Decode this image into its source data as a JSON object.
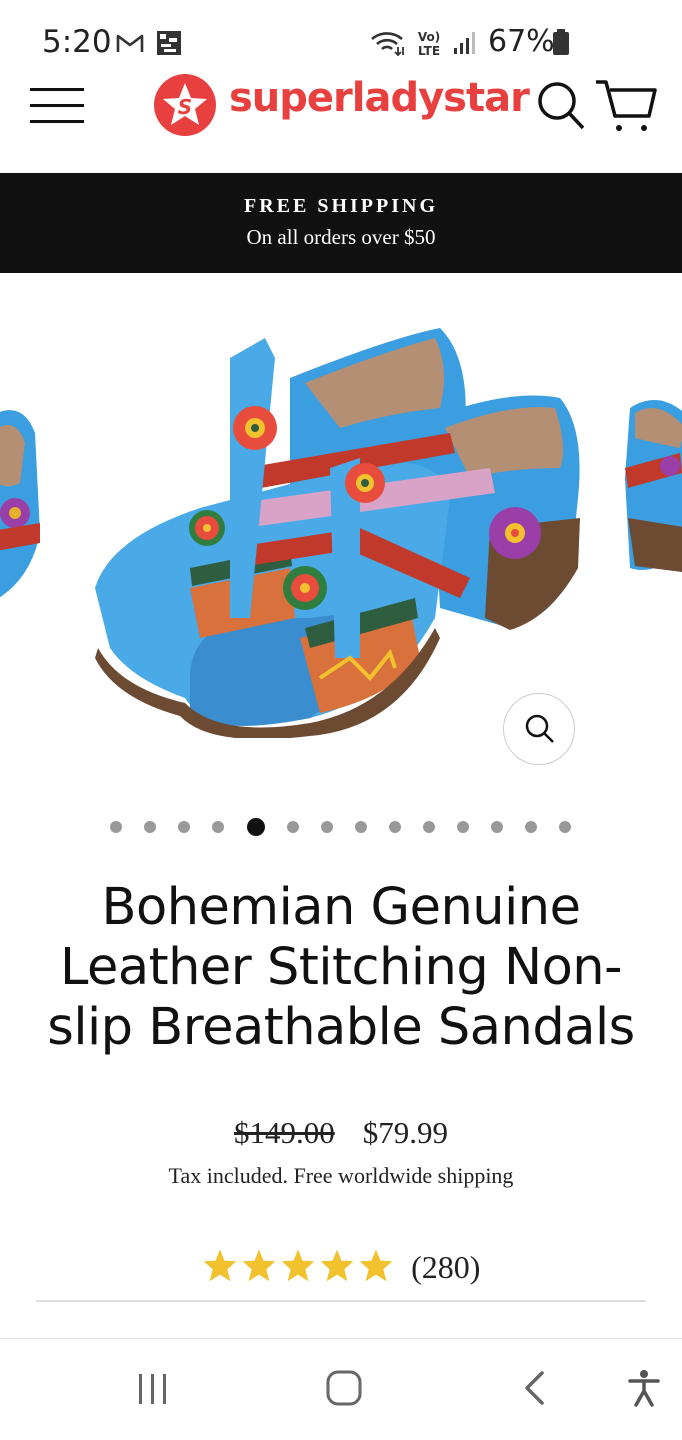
{
  "status_bar": {
    "time": "5:20",
    "network": "LTE",
    "battery": "67%",
    "icons": [
      "gmail-icon",
      "gallery-icon",
      "wifi-icon",
      "volte-icon",
      "signal-icon",
      "battery-icon"
    ]
  },
  "header": {
    "brand": "superladystar",
    "brand_color": "#e8403f",
    "icons": [
      "hamburger-icon",
      "search-icon",
      "cart-icon"
    ]
  },
  "promo": {
    "title": "FREE SHIPPING",
    "subtitle": "On all orders over $50"
  },
  "gallery": {
    "dot_count": 14,
    "active_index": 4,
    "zoom_icon": "zoom-icon"
  },
  "product": {
    "title": "Bohemian Genuine Leather Stitching Non-slip Breathable Sandals",
    "original_price": "$149.00",
    "sale_price": "$79.99",
    "tax_note": "Tax included. Free worldwide shipping",
    "rating_stars": 5,
    "review_count": "(280)",
    "star_color": "#f2c12e"
  },
  "nav_bar": {
    "icons": [
      "recent-apps-icon",
      "home-icon",
      "back-icon",
      "accessibility-icon"
    ]
  }
}
